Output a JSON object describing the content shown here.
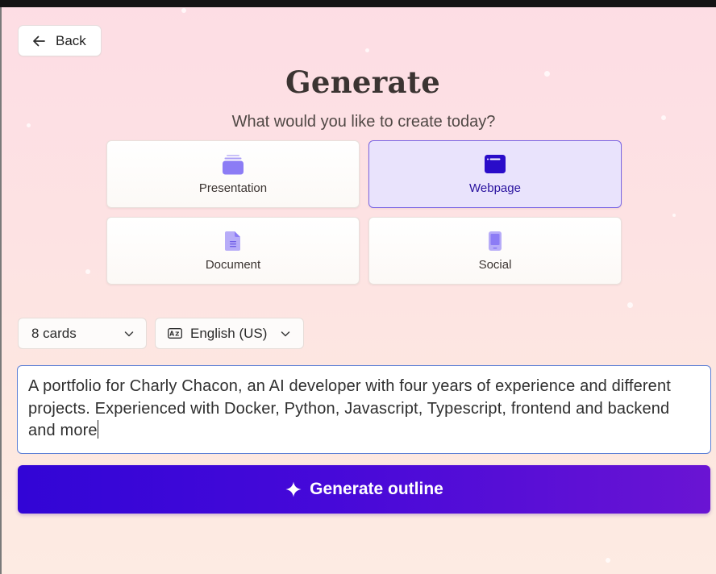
{
  "header": {
    "back_label": "Back",
    "title": "Generate",
    "subtitle": "What would you like to create today?"
  },
  "types": [
    {
      "label": "Presentation",
      "icon": "presentation-icon",
      "selected": false
    },
    {
      "label": "Webpage",
      "icon": "webpage-icon",
      "selected": true
    },
    {
      "label": "Document",
      "icon": "document-icon",
      "selected": false
    },
    {
      "label": "Social",
      "icon": "social-icon",
      "selected": false
    }
  ],
  "options": {
    "cards_value": "8 cards",
    "language_value": "English (US)",
    "language_icon": "language-icon"
  },
  "prompt": {
    "value": "A portfolio for Charly Chacon, an AI developer with four years of experience and different projects. Experienced with Docker, Python, Javascript, Typescript, frontend and backend and more"
  },
  "action": {
    "label": "Generate outline",
    "icon": "sparkle-icon"
  },
  "colors": {
    "accent": "#3205d6",
    "accent_end": "#6a14d3",
    "selected_bg": "#e9e3fc",
    "selected_border": "#7b66e4",
    "icon_purple": "#8c7cf5"
  }
}
